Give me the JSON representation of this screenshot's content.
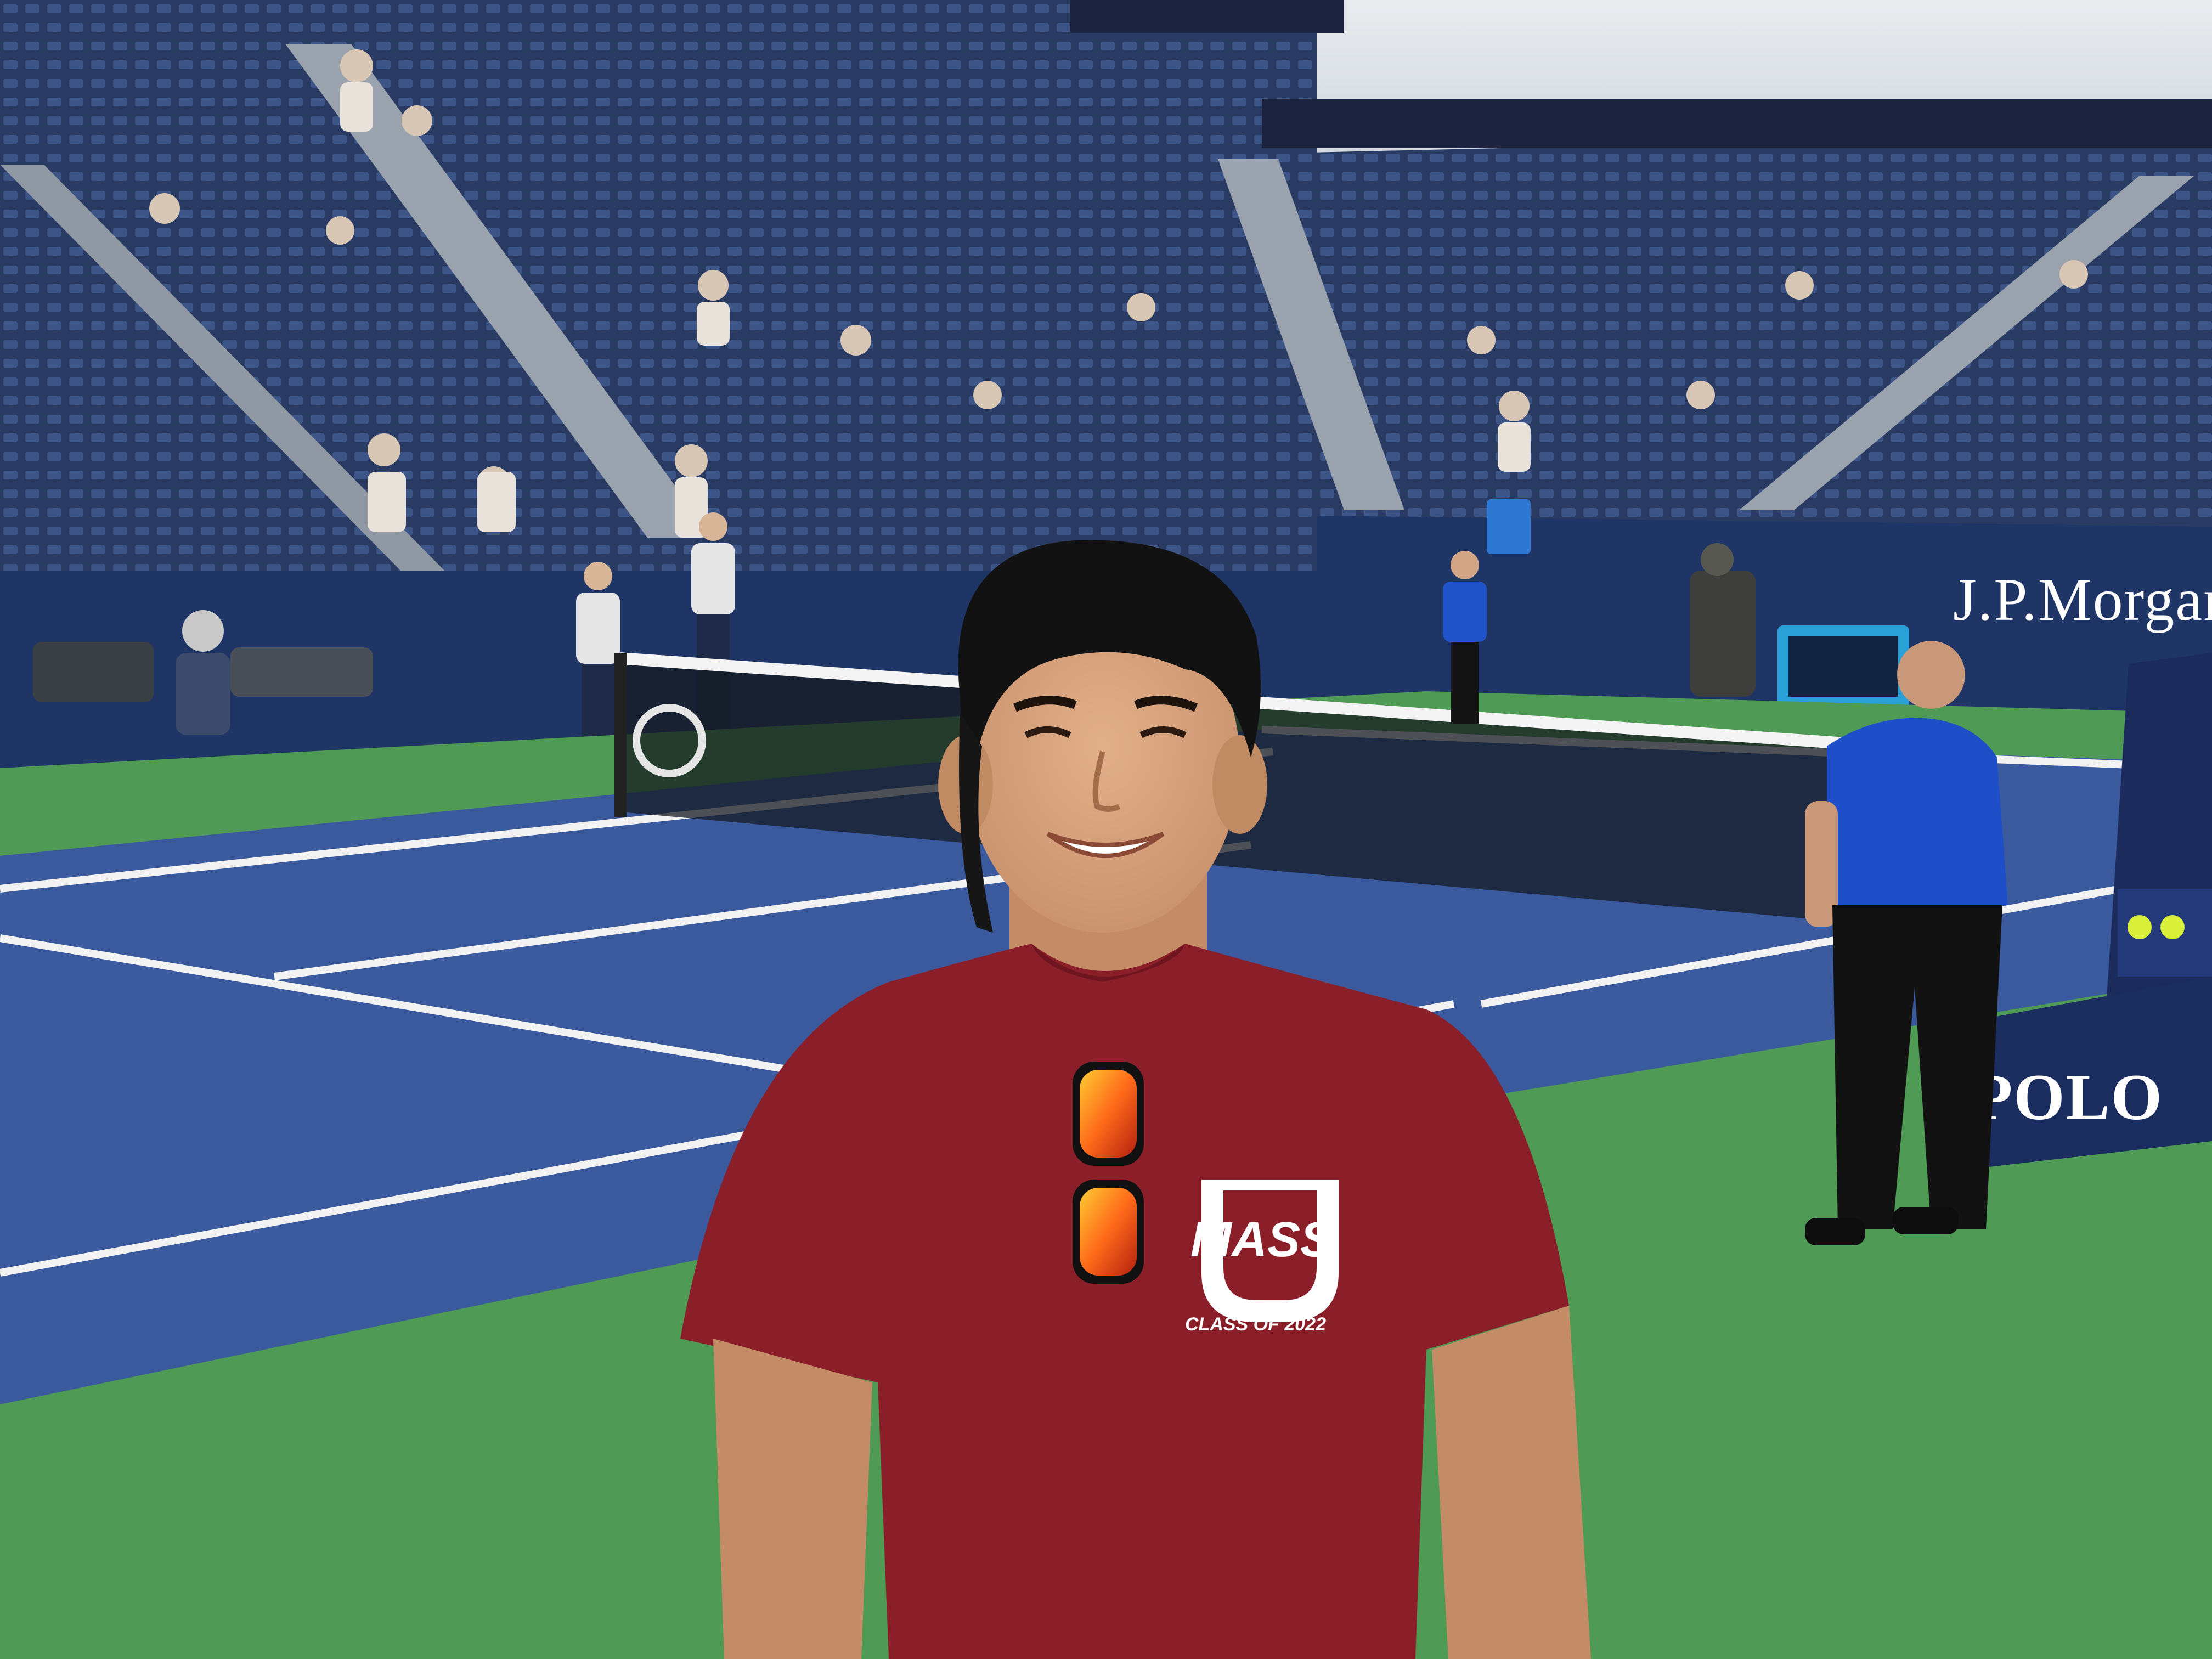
{
  "photo": {
    "signage": {
      "sponsor_wall": "J.P.Morgan",
      "umpire_stand": "POLO"
    },
    "shirt": {
      "logo": "MASS",
      "caption": "CLASS OF 2022"
    },
    "colors": {
      "court_blue": "#3b5a9e",
      "court_green": "#4f9a55",
      "wall_navy": "#1f3566",
      "shirt_maroon": "#8a1f2a",
      "steward_blue": "#1f4fc8"
    }
  }
}
